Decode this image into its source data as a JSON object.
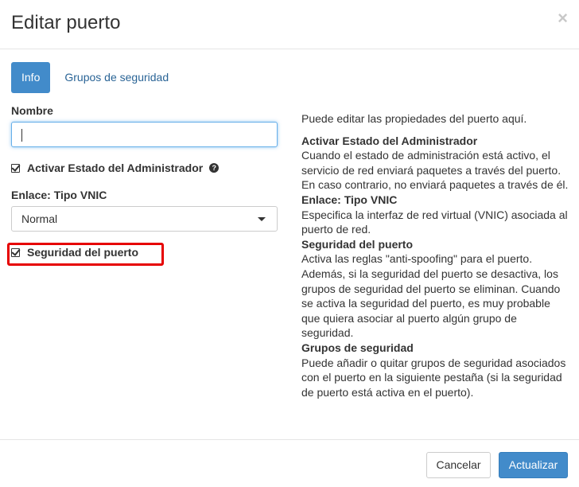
{
  "modal": {
    "title": "Editar puerto",
    "close_symbol": "×",
    "close_icon": "close-icon"
  },
  "tabs": [
    {
      "label": "Info",
      "active": true
    },
    {
      "label": "Grupos de seguridad",
      "active": false
    }
  ],
  "form": {
    "name_label": "Nombre",
    "name_value": "",
    "admin_state_label": "Activar Estado del Administrador",
    "admin_state_checked": true,
    "help_icon": "question-circle-icon",
    "help_symbol": "?",
    "vnic_label": "Enlace: Tipo VNIC",
    "vnic_selected": "Normal",
    "port_security_label": "Seguridad del puerto",
    "port_security_checked": true
  },
  "help": {
    "intro": "Puede editar las propiedades del puerto aquí.",
    "sections": [
      {
        "heading": "Activar Estado del Administrador",
        "text": "Cuando el estado de administración está activo, el servicio de red enviará paquetes a través del puerto. En caso contrario, no enviará paquetes a través de él."
      },
      {
        "heading": "Enlace: Tipo VNIC",
        "text": "Especifica la interfaz de red virtual (VNIC) asociada al puerto de red."
      },
      {
        "heading": "Seguridad del puerto",
        "text": "Activa las reglas \"anti-spoofing\" para el puerto. Además, si la seguridad del puerto se desactiva, los grupos de seguridad del puerto se eliminan. Cuando se activa la seguridad del puerto, es muy probable que quiera asociar al puerto algún grupo de seguridad."
      },
      {
        "heading": "Grupos de seguridad",
        "text": "Puede añadir o quitar grupos de seguridad asociados con el puerto en la siguiente pestaña (si la seguridad de puerto está activa en el puerto)."
      }
    ]
  },
  "footer": {
    "cancel_label": "Cancelar",
    "submit_label": "Actualizar"
  },
  "colors": {
    "primary": "#428bca",
    "link": "#2a6496",
    "highlight": "#e60000",
    "focus_border": "#66afe9"
  }
}
